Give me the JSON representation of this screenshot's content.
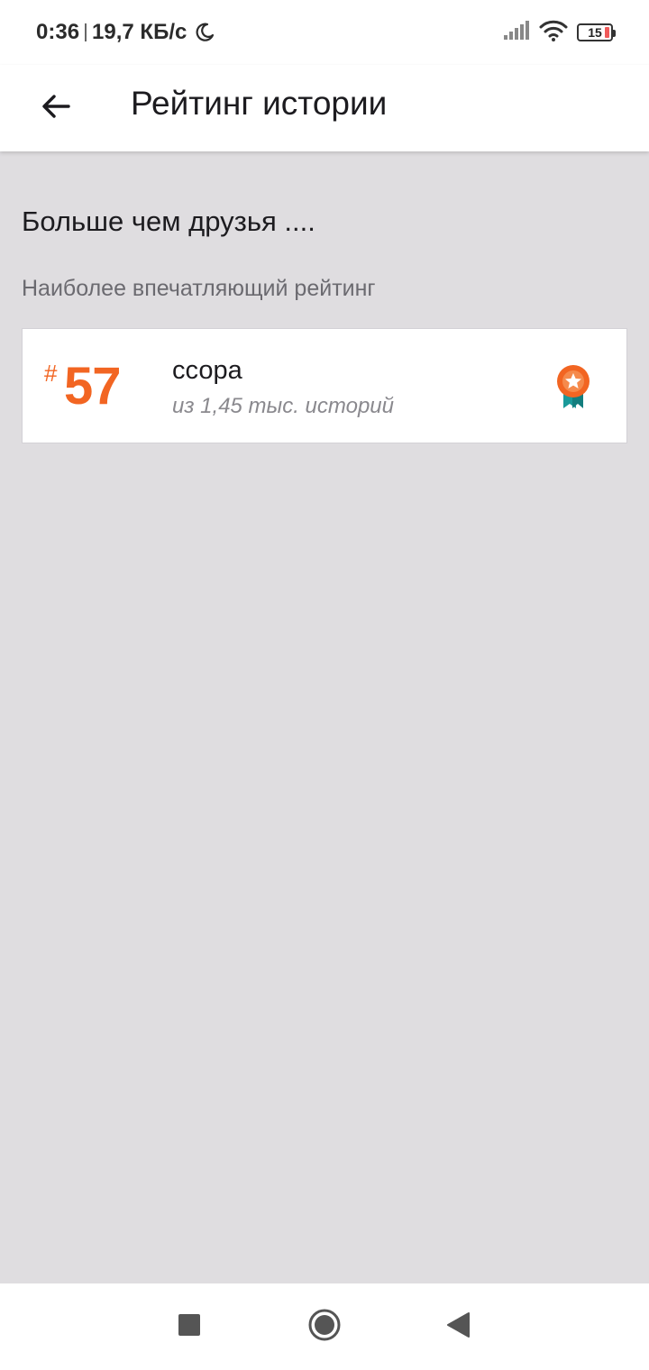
{
  "status_bar": {
    "time": "0:36",
    "speed": "19,7 КБ/с",
    "battery": "15",
    "icons": [
      "moon-icon",
      "signal-icon",
      "wifi-icon",
      "battery-icon"
    ]
  },
  "app_bar": {
    "title": "Рейтинг истории",
    "back_icon": "arrow-left-icon"
  },
  "main": {
    "heading": "Больше чем друзья ....",
    "subheading": "Наиболее впечатляющий рейтинг",
    "ranking": {
      "hash": "#",
      "rank": "57",
      "category": "ссора",
      "total": "из 1,45 тыс. историй",
      "icon": "award-icon"
    }
  },
  "nav_bar": {
    "buttons": [
      "recents-square-icon",
      "home-circle-icon",
      "back-triangle-icon"
    ]
  },
  "colors": {
    "accent": "#f26522",
    "badge_ribbon": "#1a9a9a",
    "background": "#dfdde0"
  }
}
